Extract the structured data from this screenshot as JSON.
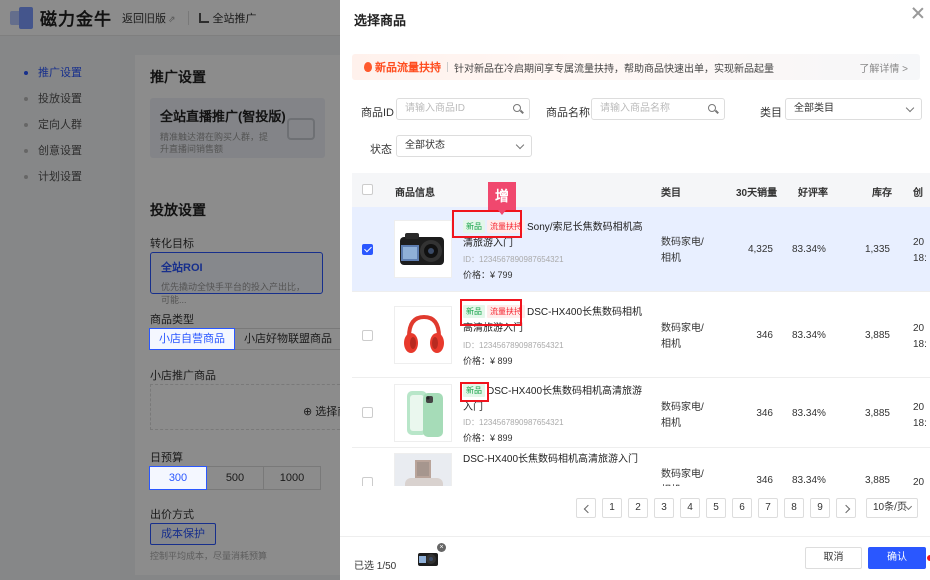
{
  "app": {
    "logo_text": "磁力金牛",
    "back_old": "返回旧版",
    "nav_label": "全站推广"
  },
  "left_nav": [
    {
      "label": "推广设置",
      "active": true
    },
    {
      "label": "投放设置",
      "active": false
    },
    {
      "label": "定向人群",
      "active": false
    },
    {
      "label": "创意设置",
      "active": false
    },
    {
      "label": "计划设置",
      "active": false
    }
  ],
  "bg": {
    "promo_heading": "推广设置",
    "promo_card_title": "全站直播推广(智投版)",
    "promo_card_desc": "精准触达潜在购买人群，提升直播间销售额",
    "delivery_heading": "投放设置",
    "target_label": "转化目标",
    "target_title": "全站ROI",
    "target_desc": "优先撬动全快手平台的投入产出比，可能...",
    "product_type_label": "商品类型",
    "product_types": [
      "小店自营商品",
      "小店好物联盟商品"
    ],
    "shop_products_label": "小店推广商品",
    "add_product": "⊕ 选择商品",
    "budget_label": "日预算",
    "budgets": [
      "300",
      "500",
      "1000"
    ],
    "bid_label": "出价方式",
    "bid_value": "成本保护",
    "bid_desc": "控制平均成本，尽量消耗预算"
  },
  "drawer": {
    "title": "选择商品",
    "banner": {
      "title": "新品流量扶持",
      "desc": "针对新品在冷启期间享专属流量扶持，帮助商品快速出单，实现新品起量",
      "more": "了解详情 >"
    },
    "filters": {
      "id_label": "商品ID",
      "id_placeholder": "请输入商品ID",
      "name_label": "商品名称",
      "name_placeholder": "请输入商品名称",
      "category_label": "类目",
      "category_value": "全部类目",
      "status_label": "状态",
      "status_value": "全部状态"
    },
    "columns": [
      "商品信息",
      "类目",
      "30天销量",
      "好评率",
      "库存",
      "创"
    ],
    "annotation_label": "增",
    "rows": [
      {
        "selected": true,
        "tags": [
          "新品",
          "流量扶持"
        ],
        "name": "Sony/索尼长焦数码相机高清旅游入门",
        "id": "ID：1234567890987654321",
        "price": "价格：¥ 799",
        "category": "数码家电/相机",
        "sales": "4,325",
        "rating": "83.34%",
        "stock": "1,335",
        "date": "20 18:"
      },
      {
        "selected": false,
        "tags": [
          "新品",
          "流量扶持"
        ],
        "name": "DSC-HX400长焦数码相机高清旅游入门",
        "id": "ID：1234567890987654321",
        "price": "价格：¥ 899",
        "category": "数码家电/相机",
        "sales": "346",
        "rating": "83.34%",
        "stock": "3,885",
        "date": "20 18:"
      },
      {
        "selected": false,
        "tags": [
          "新品"
        ],
        "name": "DSC-HX400长焦数码相机高清旅游入门",
        "id": "ID：1234567890987654321",
        "price": "价格：¥ 899",
        "category": "数码家电/相机",
        "sales": "346",
        "rating": "83.34%",
        "stock": "3,885",
        "date": "20 18:"
      },
      {
        "selected": false,
        "tags": [],
        "name": "DSC-HX400长焦数码相机高清旅游入门",
        "id": "",
        "price": "",
        "category": "数码家电/相机",
        "sales": "346",
        "rating": "83.34%",
        "stock": "3,885",
        "date": "20"
      }
    ],
    "pagination": {
      "pages": [
        "1",
        "2",
        "3",
        "4",
        "5",
        "6",
        "7",
        "8",
        "9"
      ],
      "page_size": "10条/页"
    },
    "footer": {
      "selected_count": "已选 1/50",
      "cancel": "取消",
      "confirm": "确认"
    }
  },
  "colors": {
    "primary": "#2a57ff",
    "new_tag": "#17a34a",
    "flow_tag": "#f5222d",
    "annotation": "#f0141e"
  }
}
